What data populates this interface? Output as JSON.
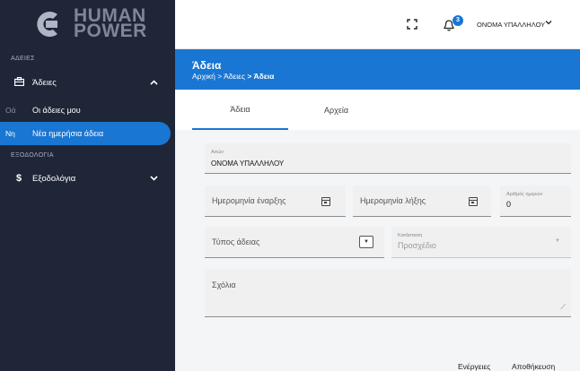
{
  "brand": {
    "line1": "HUMAN",
    "line2": "POWER"
  },
  "sidebar": {
    "section_leaves": "ΑΔΕΙΕΣ",
    "leaves_label": "Άδειες",
    "sub_items": [
      {
        "abbr": "Οά",
        "label": "Οι άδειες μου"
      },
      {
        "abbr": "Νη",
        "label": "Νέα ημερήσια άδεια"
      }
    ],
    "section_expenses": "ΕΞΟΔΟΛΟΓΙΑ",
    "expenses_label": "Εξοδολόγια"
  },
  "topbar": {
    "badge": "3",
    "user_name": "ΟΝΟΜΑ ΥΠΑΛΛΗΛΟΥ"
  },
  "banner": {
    "title": "Άδεια",
    "crumbs": [
      "Αρχική",
      "Άδειες",
      "Άδεια"
    ]
  },
  "tabs": [
    "Άδεια",
    "Αρχεία"
  ],
  "form": {
    "requester_label": "Αιτών",
    "requester_value": "ΟΝΟΜΑ ΥΠΑΛΛΗΛΟΥ",
    "start_date_placeholder": "Ημερομηνία έναρξης",
    "end_date_placeholder": "Ημερομηνία λήξης",
    "days_label": "Αριθμός ημερών",
    "days_value": "0",
    "leave_type_placeholder": "Τύπος άδειας",
    "status_label": "Κατάσταση",
    "status_value": "Προσχέδιο",
    "comments_placeholder": "Σχόλια"
  },
  "actions": {
    "actions_label": "Ενέργειες",
    "save_label": "Αποθήκευση"
  },
  "colors": {
    "sidebar_bg": "#1e2638",
    "accent": "#1976d2"
  }
}
